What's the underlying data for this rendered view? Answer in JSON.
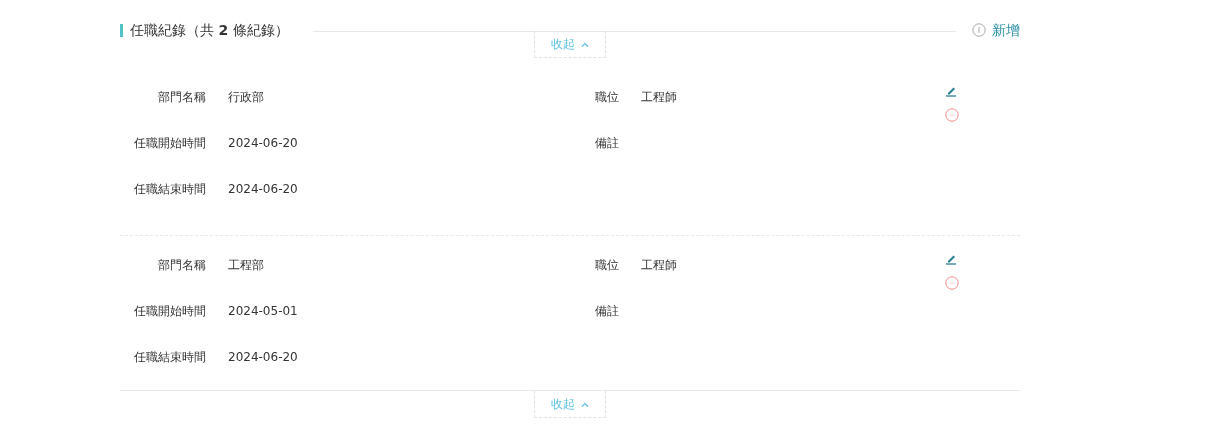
{
  "section": {
    "title": "任職紀錄（共 **2** 條紀錄）",
    "add_label": "新增",
    "collapse_top": "收起",
    "collapse_bottom": "收起"
  },
  "records": [
    {
      "fields": [
        {
          "label": "部門名稱",
          "value": "行政部"
        },
        {
          "label": "職位",
          "value": "工程師"
        },
        {
          "label": "任職開始時間",
          "value": "2024-06-20"
        },
        {
          "label": "備註"
        },
        {
          "label": "任職結束時間",
          "value": "2024-06-20"
        }
      ]
    },
    {
      "fields": [
        {
          "label": "部門名稱",
          "value": "工程部"
        },
        {
          "label": "職位",
          "value": "工程師"
        },
        {
          "label": "任職開始時間",
          "value": "2024-05-01"
        },
        {
          "label": "備註"
        },
        {
          "label": "任職結束時間",
          "value": "2024-06-20"
        }
      ]
    }
  ]
}
